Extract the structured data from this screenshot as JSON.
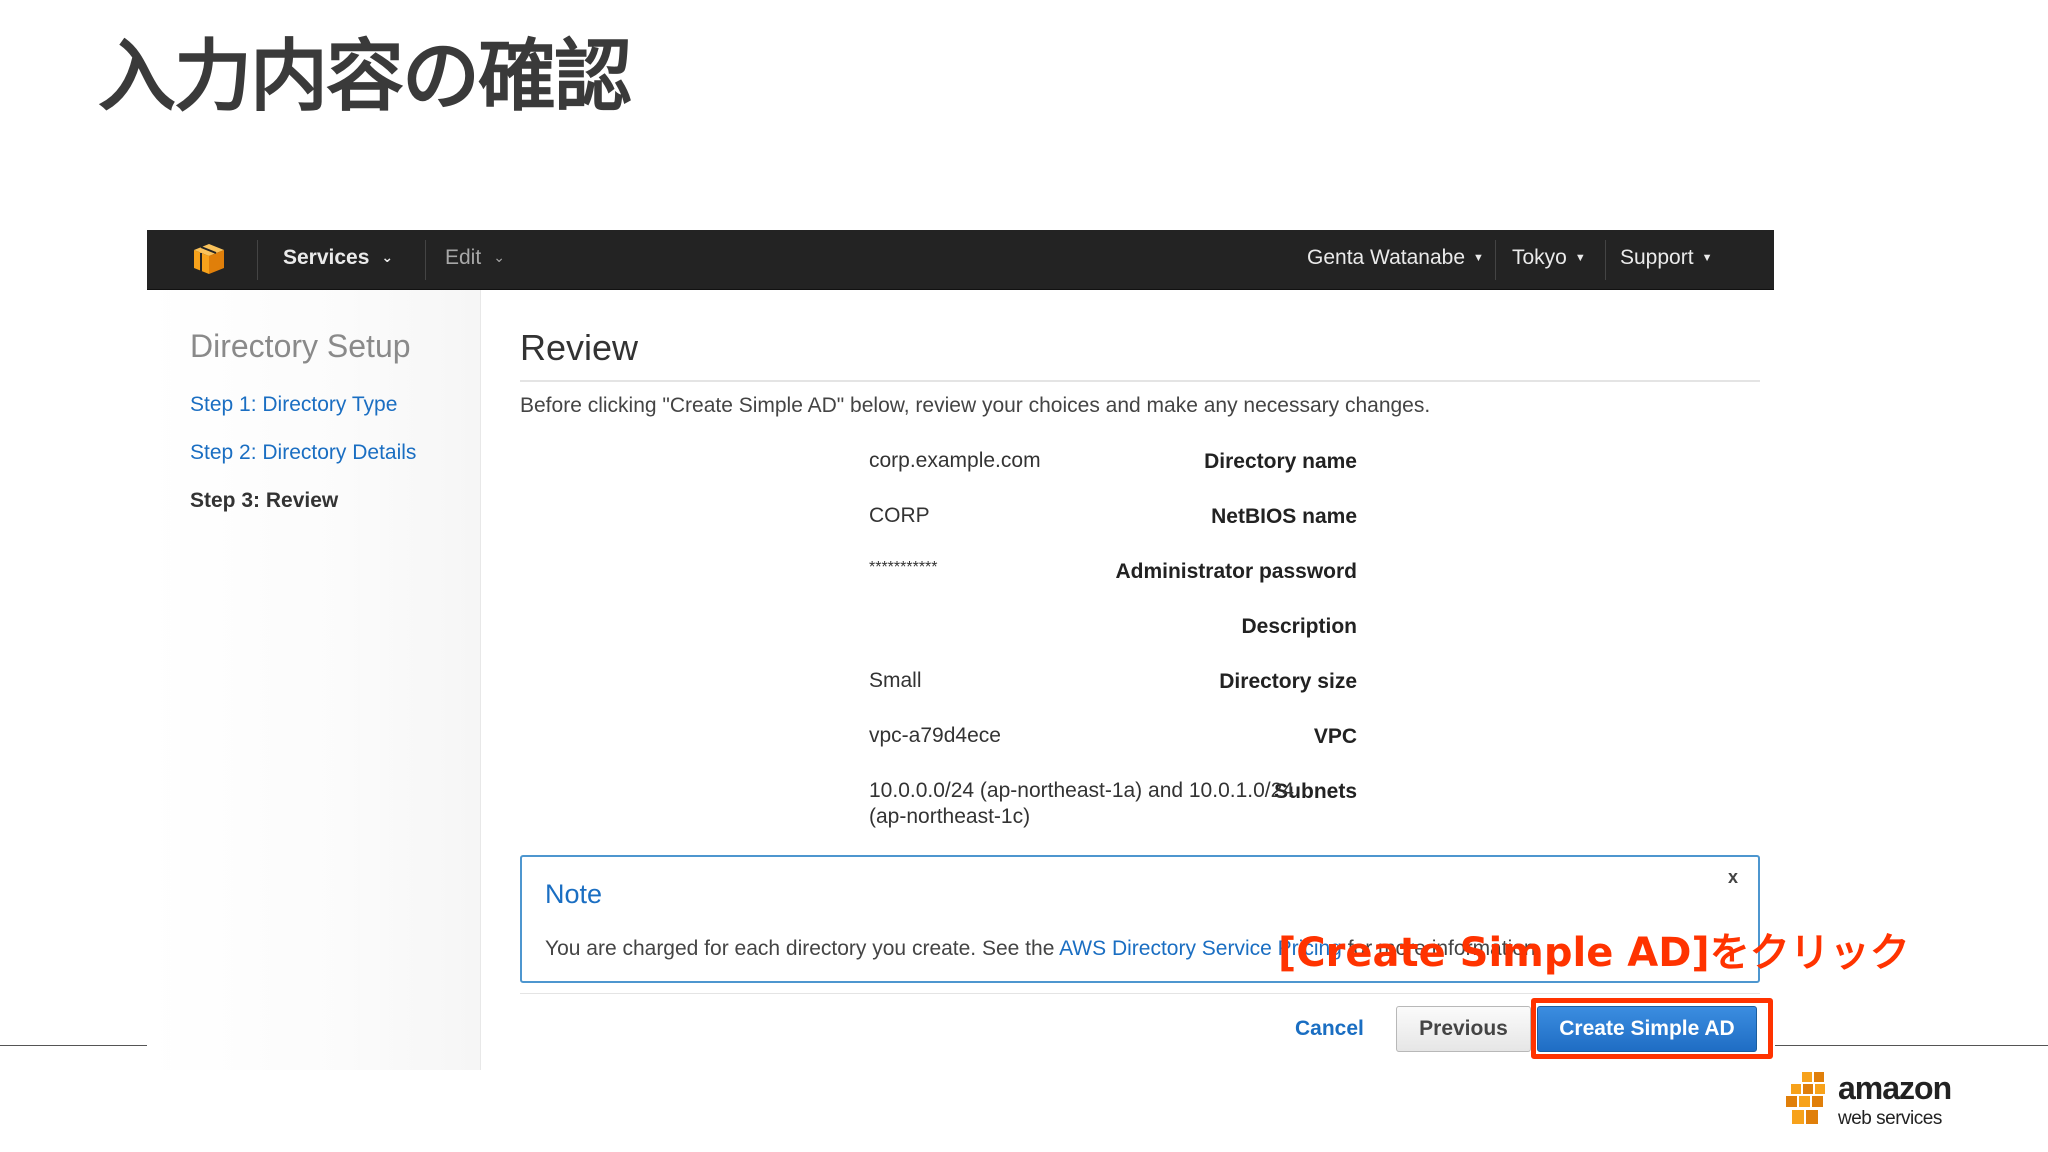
{
  "slide": {
    "title": "入力内容の確認",
    "callout": "[Create Simple AD]をクリック"
  },
  "navbar": {
    "services_label": "Services",
    "edit_label": "Edit",
    "user_label": "Genta Watanabe",
    "region_label": "Tokyo",
    "support_label": "Support"
  },
  "sidebar": {
    "title": "Directory Setup",
    "steps": [
      {
        "label": "Step 1: Directory Type"
      },
      {
        "label": "Step 2: Directory Details"
      },
      {
        "label": "Step 3: Review"
      }
    ]
  },
  "review": {
    "title": "Review",
    "intro": "Before clicking \"Create Simple AD\" below, review your choices and make any necessary changes.",
    "rows": [
      {
        "label": "Directory name",
        "value": "corp.example.com"
      },
      {
        "label": "NetBIOS name",
        "value": "CORP"
      },
      {
        "label": "Administrator password",
        "value": "***********"
      },
      {
        "label": "Description",
        "value": ""
      },
      {
        "label": "Directory size",
        "value": "Small"
      },
      {
        "label": "VPC",
        "value": "vpc-a79d4ece"
      },
      {
        "label": "Subnets",
        "value_line1": "10.0.0.0/24 (ap-northeast-1a) and 10.0.1.0/24",
        "value_line2": "(ap-northeast-1c)"
      }
    ]
  },
  "note": {
    "title": "Note",
    "text": "You are charged for each directory you create. See the ",
    "link": "AWS Directory Service Pricing",
    "text_after": " for more information.",
    "close": "x"
  },
  "buttons": {
    "cancel": "Cancel",
    "previous": "Previous",
    "create": "Create Simple AD"
  },
  "logo": {
    "word1": "amazon",
    "word2": "web services"
  },
  "colors": {
    "link": "#1a6ec2",
    "primary_button": "#1f6dc4",
    "highlight": "#ff3300",
    "navbar": "#232323",
    "aws_orange": "#f7a21b"
  }
}
